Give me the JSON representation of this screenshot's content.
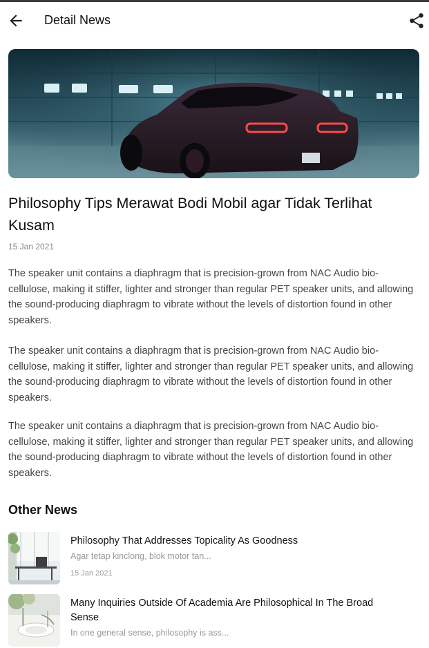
{
  "appbar": {
    "title": "Detail News",
    "back_icon": "arrow-left-icon",
    "share_icon": "share-icon"
  },
  "article": {
    "headline": "Philosophy Tips Merawat Bodi Mobil agar Tidak Terlihat Kusam",
    "date": "15 Jan 2021",
    "paragraphs": [
      "The speaker unit contains a diaphragm that is precision-grown from NAC Audio bio-cellulose, making it stiffer, lighter and stronger than regular PET speaker units, and allowing the sound-producing diaphragm to vibrate without the levels of distortion found in other speakers.",
      "The speaker unit contains a diaphragm that is precision-grown from NAC Audio bio-cellulose, making it stiffer, lighter and stronger than regular PET speaker units, and allowing the sound-producing diaphragm to vibrate without the levels of distortion found in other speakers.",
      "The speaker unit contains a diaphragm that is precision-grown from NAC Audio bio-cellulose, making it stiffer, lighter and stronger than regular PET speaker units, and allowing the sound-producing diaphragm to vibrate without the levels of distortion found in other speakers."
    ]
  },
  "other_news": {
    "title": "Other News",
    "items": [
      {
        "title": "Philosophy That Addresses Topicality As Goodness",
        "description": "Agar tetap kinclong, blok motor tan...",
        "date": "15 Jan 2021"
      },
      {
        "title": "Many Inquiries Outside Of Academia Are Philosophical In The Broad Sense",
        "description": "In one general sense, philosophy is ass..."
      }
    ]
  },
  "colors": {
    "text_primary": "#111111",
    "text_body": "#444444",
    "text_muted": "#999999",
    "status_line": "#3a3a3a"
  }
}
